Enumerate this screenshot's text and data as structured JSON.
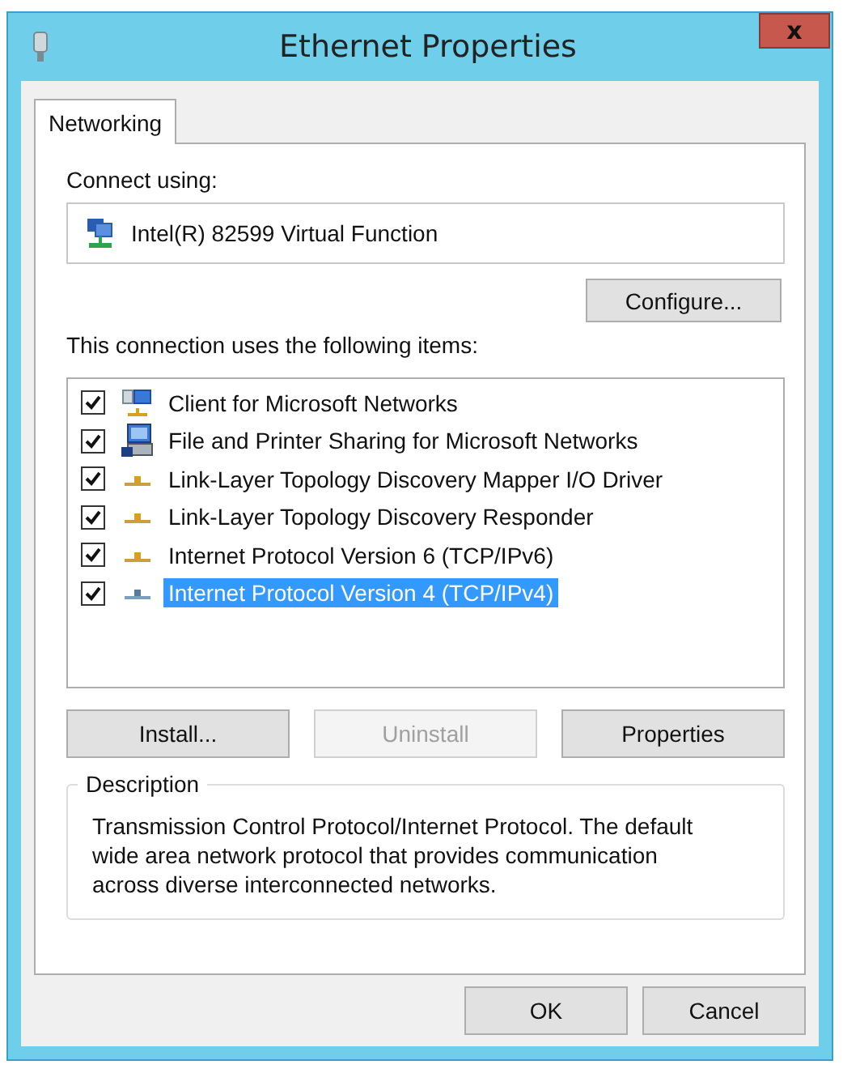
{
  "window": {
    "title": "Ethernet Properties",
    "close": "x"
  },
  "tabs": [
    {
      "label": "Networking",
      "selected": true
    }
  ],
  "connect_using": {
    "label": "Connect using:",
    "adapter": "Intel(R) 82599 Virtual Function"
  },
  "configure_button": "Configure...",
  "items_label": "This connection uses the following items:",
  "items": [
    {
      "kind": "client",
      "label": "Client for Microsoft Networks",
      "checked": true,
      "selected": false
    },
    {
      "kind": "service",
      "label": "File and Printer Sharing for Microsoft Networks",
      "checked": true,
      "selected": false
    },
    {
      "kind": "protocol",
      "label": "Link-Layer Topology Discovery Mapper I/O Driver",
      "checked": true,
      "selected": false
    },
    {
      "kind": "protocol",
      "label": "Link-Layer Topology Discovery Responder",
      "checked": true,
      "selected": false
    },
    {
      "kind": "protocol",
      "label": "Internet Protocol Version 6 (TCP/IPv6)",
      "checked": true,
      "selected": false
    },
    {
      "kind": "protocol",
      "label": "Internet Protocol Version 4 (TCP/IPv4)",
      "checked": true,
      "selected": true
    }
  ],
  "item_buttons": [
    {
      "label": "Install...",
      "disabled": false
    },
    {
      "label": "Uninstall",
      "disabled": true
    },
    {
      "label": "Properties",
      "disabled": false
    }
  ],
  "description": {
    "legend": "Description",
    "text": "Transmission Control Protocol/Internet Protocol. The default wide area network protocol that provides communication across diverse interconnected networks."
  },
  "buttons": [
    "OK",
    "Cancel"
  ]
}
